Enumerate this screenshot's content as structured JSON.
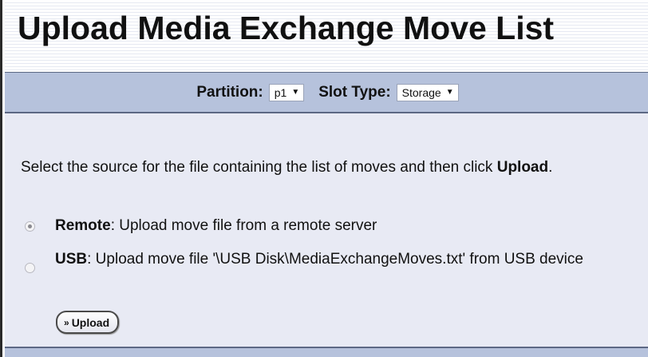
{
  "header": {
    "title": "Upload Media Exchange Move List"
  },
  "toolbar": {
    "partition_label": "Partition:",
    "partition_value": "p1",
    "slot_type_label": "Slot Type:",
    "slot_type_value": "Storage",
    "dropdown_icon": "triangle-down"
  },
  "main": {
    "intro_text": "Select the source for the file containing the list of moves and then click ",
    "intro_bold": "Upload",
    "intro_end": ".",
    "options": [
      {
        "label": "Remote",
        "description": ": Upload move file from a remote server",
        "selected": true
      },
      {
        "label": "USB",
        "description": ": Upload move file '\\USB Disk\\MediaExchangeMoves.txt' from USB device",
        "selected": false
      }
    ],
    "upload_button": {
      "icon": "double-chevron-right",
      "label": "Upload"
    }
  },
  "colors": {
    "toolbar_bg": "#b6c2dc",
    "panel_bg": "#e8eaf4",
    "border": "#5c6884"
  }
}
